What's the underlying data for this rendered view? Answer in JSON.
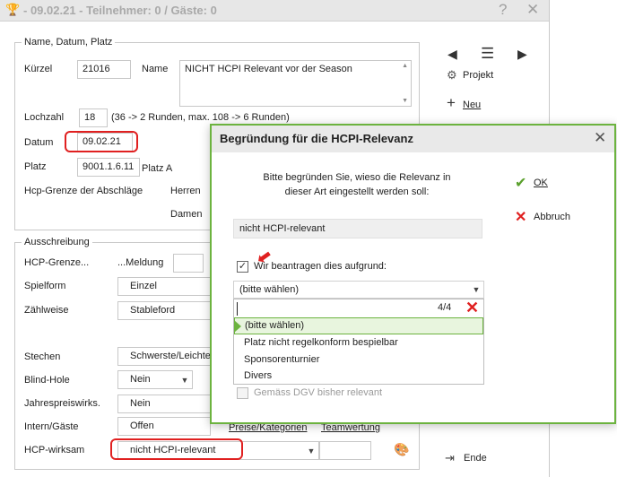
{
  "window": {
    "title": "- 09.02.21 - Teilnehmer: 0 / Gäste: 0",
    "help": "?",
    "close": "✕"
  },
  "section1": {
    "title": "Name, Datum, Platz",
    "kuerzel_label": "Kürzel",
    "kuerzel_value": "21016",
    "name_label": "Name",
    "name_value": "NICHT HCPI Relevant vor der Season",
    "lochzahl_label": "Lochzahl",
    "lochzahl_value": "18",
    "lochzahl_hint": "(36 -> 2 Runden, max. 108 -> 6 Runden)",
    "datum_label": "Datum",
    "datum_value": "09.02.21",
    "platz_label": "Platz",
    "platz_value": "9001.1.6.11",
    "platz_name": "Platz A",
    "hcp_grenze_label": "Hcp-Grenze der Abschläge",
    "herren_label": "Herren",
    "damen_label": "Damen"
  },
  "section2": {
    "title": "Ausschreibung",
    "hcp_grenze_label": "HCP-Grenze...",
    "meldung_label": "...Meldung",
    "spielform_label": "Spielform",
    "spielform_value": "Einzel",
    "zaehlweise_label": "Zählweise",
    "zaehlweise_value": "Stableford",
    "stechen_label": "Stechen",
    "stechen_value": "Schwerste/Leichte",
    "blind_label": "Blind-Hole",
    "blind_value": "Nein",
    "jahres_label": "Jahrespreiswirks.",
    "jahres_value": "Nein",
    "intern_label": "Intern/Gäste",
    "intern_value": "Offen",
    "preise_label": "Preise/Kategorien",
    "team_label": "Teamwertung",
    "hcp_wirksam_label": "HCP-wirksam",
    "hcp_wirksam_value": "nicht HCPI-relevant"
  },
  "side": {
    "projekt": "Projekt",
    "neu": "Neu",
    "ende": "Ende"
  },
  "dialog": {
    "title": "Begründung für die HCPI-Relevanz",
    "prompt": "Bitte begründen Sie, wieso die Relevanz in dieser Art eingestellt werden soll:",
    "current_value": "nicht HCPI-relevant",
    "checkbox_label": "Wir beantragen dies aufgrund:",
    "select_value": "(bitte wählen)",
    "search_count": "4/4",
    "options": [
      "(bitte wählen)",
      "Platz nicht regelkonform bespielbar",
      "Sponsorenturnier",
      "Divers"
    ],
    "dgv_label": "Gemäss DGV bisher relevant",
    "ok": "OK",
    "abbruch": "Abbruch"
  },
  "colors": {
    "accent_green": "#6cb33f",
    "highlight_red": "#e02020"
  }
}
